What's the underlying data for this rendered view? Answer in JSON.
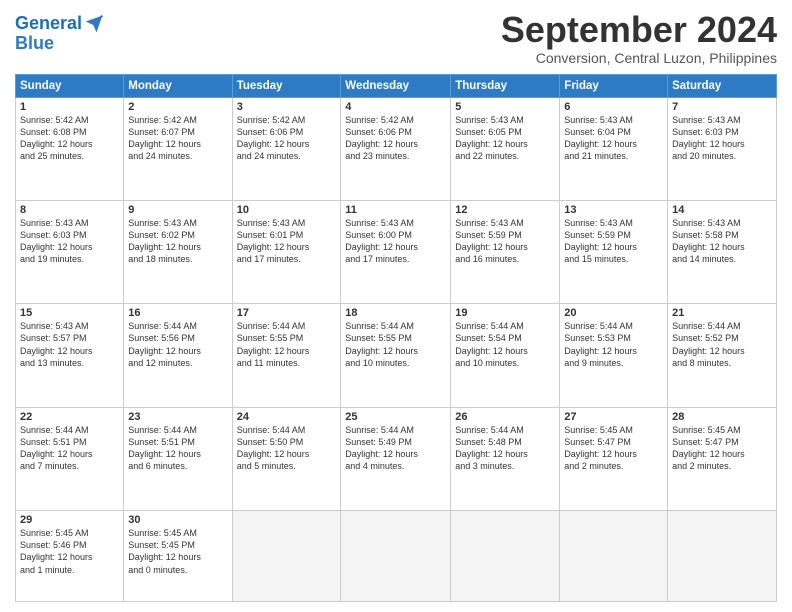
{
  "header": {
    "logo_line1": "General",
    "logo_line2": "Blue",
    "month_title": "September 2024",
    "subtitle": "Conversion, Central Luzon, Philippines"
  },
  "weekdays": [
    "Sunday",
    "Monday",
    "Tuesday",
    "Wednesday",
    "Thursday",
    "Friday",
    "Saturday"
  ],
  "weeks": [
    [
      {
        "day": "1",
        "info": "Sunrise: 5:42 AM\nSunset: 6:08 PM\nDaylight: 12 hours\nand 25 minutes."
      },
      {
        "day": "2",
        "info": "Sunrise: 5:42 AM\nSunset: 6:07 PM\nDaylight: 12 hours\nand 24 minutes."
      },
      {
        "day": "3",
        "info": "Sunrise: 5:42 AM\nSunset: 6:06 PM\nDaylight: 12 hours\nand 24 minutes."
      },
      {
        "day": "4",
        "info": "Sunrise: 5:42 AM\nSunset: 6:06 PM\nDaylight: 12 hours\nand 23 minutes."
      },
      {
        "day": "5",
        "info": "Sunrise: 5:43 AM\nSunset: 6:05 PM\nDaylight: 12 hours\nand 22 minutes."
      },
      {
        "day": "6",
        "info": "Sunrise: 5:43 AM\nSunset: 6:04 PM\nDaylight: 12 hours\nand 21 minutes."
      },
      {
        "day": "7",
        "info": "Sunrise: 5:43 AM\nSunset: 6:03 PM\nDaylight: 12 hours\nand 20 minutes."
      }
    ],
    [
      {
        "day": "8",
        "info": "Sunrise: 5:43 AM\nSunset: 6:03 PM\nDaylight: 12 hours\nand 19 minutes."
      },
      {
        "day": "9",
        "info": "Sunrise: 5:43 AM\nSunset: 6:02 PM\nDaylight: 12 hours\nand 18 minutes."
      },
      {
        "day": "10",
        "info": "Sunrise: 5:43 AM\nSunset: 6:01 PM\nDaylight: 12 hours\nand 17 minutes."
      },
      {
        "day": "11",
        "info": "Sunrise: 5:43 AM\nSunset: 6:00 PM\nDaylight: 12 hours\nand 17 minutes."
      },
      {
        "day": "12",
        "info": "Sunrise: 5:43 AM\nSunset: 5:59 PM\nDaylight: 12 hours\nand 16 minutes."
      },
      {
        "day": "13",
        "info": "Sunrise: 5:43 AM\nSunset: 5:59 PM\nDaylight: 12 hours\nand 15 minutes."
      },
      {
        "day": "14",
        "info": "Sunrise: 5:43 AM\nSunset: 5:58 PM\nDaylight: 12 hours\nand 14 minutes."
      }
    ],
    [
      {
        "day": "15",
        "info": "Sunrise: 5:43 AM\nSunset: 5:57 PM\nDaylight: 12 hours\nand 13 minutes."
      },
      {
        "day": "16",
        "info": "Sunrise: 5:44 AM\nSunset: 5:56 PM\nDaylight: 12 hours\nand 12 minutes."
      },
      {
        "day": "17",
        "info": "Sunrise: 5:44 AM\nSunset: 5:55 PM\nDaylight: 12 hours\nand 11 minutes."
      },
      {
        "day": "18",
        "info": "Sunrise: 5:44 AM\nSunset: 5:55 PM\nDaylight: 12 hours\nand 10 minutes."
      },
      {
        "day": "19",
        "info": "Sunrise: 5:44 AM\nSunset: 5:54 PM\nDaylight: 12 hours\nand 10 minutes."
      },
      {
        "day": "20",
        "info": "Sunrise: 5:44 AM\nSunset: 5:53 PM\nDaylight: 12 hours\nand 9 minutes."
      },
      {
        "day": "21",
        "info": "Sunrise: 5:44 AM\nSunset: 5:52 PM\nDaylight: 12 hours\nand 8 minutes."
      }
    ],
    [
      {
        "day": "22",
        "info": "Sunrise: 5:44 AM\nSunset: 5:51 PM\nDaylight: 12 hours\nand 7 minutes."
      },
      {
        "day": "23",
        "info": "Sunrise: 5:44 AM\nSunset: 5:51 PM\nDaylight: 12 hours\nand 6 minutes."
      },
      {
        "day": "24",
        "info": "Sunrise: 5:44 AM\nSunset: 5:50 PM\nDaylight: 12 hours\nand 5 minutes."
      },
      {
        "day": "25",
        "info": "Sunrise: 5:44 AM\nSunset: 5:49 PM\nDaylight: 12 hours\nand 4 minutes."
      },
      {
        "day": "26",
        "info": "Sunrise: 5:44 AM\nSunset: 5:48 PM\nDaylight: 12 hours\nand 3 minutes."
      },
      {
        "day": "27",
        "info": "Sunrise: 5:45 AM\nSunset: 5:47 PM\nDaylight: 12 hours\nand 2 minutes."
      },
      {
        "day": "28",
        "info": "Sunrise: 5:45 AM\nSunset: 5:47 PM\nDaylight: 12 hours\nand 2 minutes."
      }
    ],
    [
      {
        "day": "29",
        "info": "Sunrise: 5:45 AM\nSunset: 5:46 PM\nDaylight: 12 hours\nand 1 minute."
      },
      {
        "day": "30",
        "info": "Sunrise: 5:45 AM\nSunset: 5:45 PM\nDaylight: 12 hours\nand 0 minutes."
      },
      {
        "day": "",
        "info": ""
      },
      {
        "day": "",
        "info": ""
      },
      {
        "day": "",
        "info": ""
      },
      {
        "day": "",
        "info": ""
      },
      {
        "day": "",
        "info": ""
      }
    ]
  ]
}
